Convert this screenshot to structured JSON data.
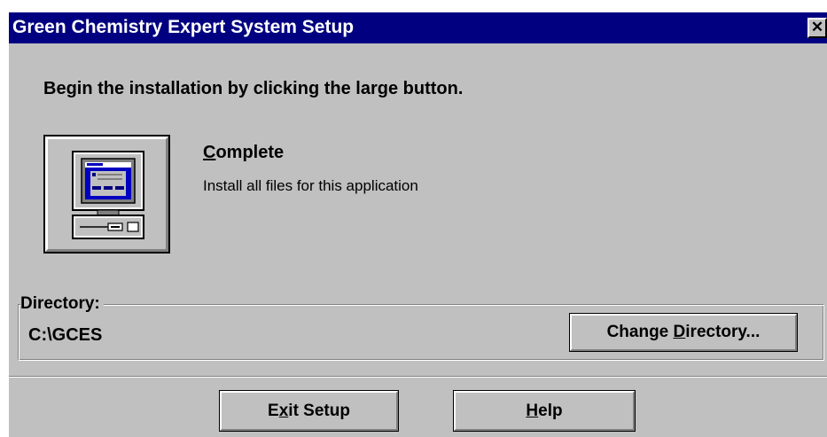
{
  "window": {
    "title": "Green Chemistry Expert System Setup",
    "close_glyph": "✕"
  },
  "instruction": "Begin the installation by clicking the large button.",
  "option": {
    "title_mnemonic": "C",
    "title_rest": "omplete",
    "description": "Install all files for this application",
    "icon": "computer-icon"
  },
  "directory": {
    "label": "Directory:",
    "value": "C:\\GCES",
    "change_button": {
      "before": "Change ",
      "mnemonic": "D",
      "after": "irectory..."
    }
  },
  "buttons": {
    "exit": {
      "before": "E",
      "mnemonic": "x",
      "after": "it Setup"
    },
    "help": {
      "before": "",
      "mnemonic": "H",
      "after": "elp"
    }
  },
  "colors": {
    "titlebar": "#000080",
    "face": "#c0c0c0",
    "screen": "#0000c0"
  }
}
